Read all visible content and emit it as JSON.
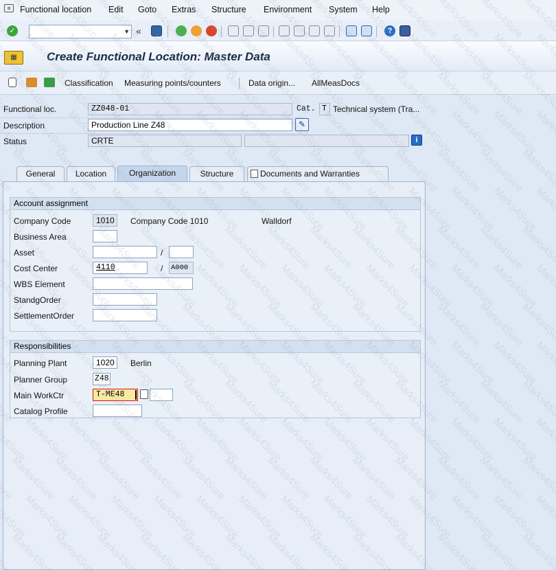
{
  "menu": {
    "items": [
      "Functional location",
      "Edit",
      "Goto",
      "Extras",
      "Structure",
      "Environment",
      "System",
      "Help"
    ]
  },
  "toolbar": {
    "command_value": "",
    "icons": [
      "enter-icon",
      "save-icon",
      "back-icon",
      "exit-icon",
      "cancel-icon",
      "print-icon",
      "find-icon",
      "find-next-icon",
      "first-page-icon",
      "prev-page-icon",
      "next-page-icon",
      "last-page-icon",
      "new-session-icon",
      "shortcut-icon",
      "help-icon",
      "customize-icon"
    ]
  },
  "title": "Create Functional Location: Master Data",
  "apptoolbar": {
    "classification": "Classification",
    "measuring_points": "Measuring points/counters",
    "data_origin": "Data origin...",
    "allmeasdocs": "AllMeasDocs"
  },
  "header": {
    "functional_loc_label": "Functional loc.",
    "functional_loc_value": "ZZ048-01",
    "cat_label": "Cat.",
    "cat_value": "T",
    "cat_text": "Technical system (Tra...",
    "description_label": "Description",
    "description_value": "Production Line Z48",
    "status_label": "Status",
    "status_value": "CRTE"
  },
  "tabs": [
    "General",
    "Location",
    "Organization",
    "Structure",
    "Documents and Warranties"
  ],
  "account_assignment": {
    "title": "Account assignment",
    "company_code_label": "Company Code",
    "company_code_value": "1010",
    "company_code_text": "Company Code 1010",
    "company_code_city": "Walldorf",
    "business_area_label": "Business Area",
    "business_area_value": "",
    "asset_label": "Asset",
    "asset_value": "",
    "asset_sub_value": "",
    "cost_center_label": "Cost Center",
    "cost_center_value": "4110",
    "cost_center_area": "A000",
    "wbs_label": "WBS Element",
    "wbs_value": "",
    "standing_order_label": "StandgOrder",
    "standing_order_value": "",
    "settlement_order_label": "SettlementOrder",
    "settlement_order_value": ""
  },
  "responsibilities": {
    "title": "Responsibilities",
    "planning_plant_label": "Planning Plant",
    "planning_plant_value": "1020",
    "planning_plant_text": "Berlin",
    "planner_group_label": "Planner Group",
    "planner_group_value": "Z48",
    "main_workctr_label": "Main WorkCtr",
    "main_workctr_value": "T-ME48",
    "main_workctr_plant": "",
    "catalog_profile_label": "Catalog Profile",
    "catalog_profile_value": ""
  },
  "watermark": "Marks4Sure"
}
